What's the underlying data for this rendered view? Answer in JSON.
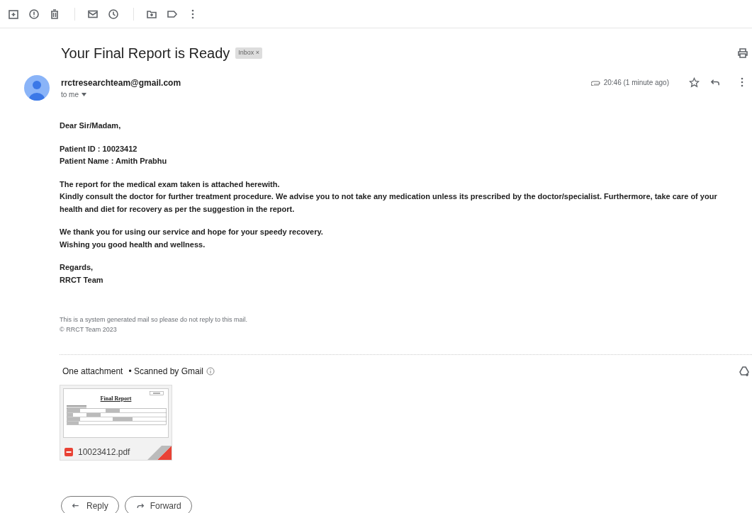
{
  "toolbar": {
    "buttons": [
      {
        "kind": "archive"
      },
      {
        "kind": "spam"
      },
      {
        "kind": "delete"
      },
      {
        "kind": "divider"
      },
      {
        "kind": "unread"
      },
      {
        "kind": "snooze"
      },
      {
        "kind": "divider"
      },
      {
        "kind": "move"
      },
      {
        "kind": "label"
      },
      {
        "kind": "more"
      }
    ]
  },
  "subject": "Your Final Report is Ready",
  "label_tag": {
    "text": "Inbox",
    "close": "×"
  },
  "sender": {
    "email": "rrctresearchteam@gmail.com",
    "to": "to me",
    "time": "20:46 (1 minute ago)",
    "has_attachment": true,
    "starred": false
  },
  "body": [
    {
      "lines": [
        "Dear Sir/Madam,"
      ]
    },
    {
      "lines": [
        "Patient ID : 10023412",
        "Patient Name : Amith Prabhu"
      ]
    },
    {
      "lines": [
        "The report for the medical exam taken is attached herewith.",
        "Kindly consult the doctor for further treatment procedure. We advise you to not take any medication unless its prescribed by the doctor/specialist. Furthermore, take care of your health and diet for recovery as per the suggestion in the report."
      ]
    },
    {
      "lines": [
        "We thank you for using our service and hope for your speedy recovery.",
        "Wishing you good health and wellness."
      ]
    },
    {
      "lines": [
        "Regards,",
        "RRCT Team"
      ]
    }
  ],
  "footer": [
    "This is a system generated mail so please do not reply to this mail.",
    "© RRCT Team 2023"
  ],
  "attachments": {
    "heading": "One attachment",
    "scan_note": "• Scanned by Gmail",
    "files": [
      {
        "name": "10023412.pdf",
        "preview_title": "Final Report"
      }
    ]
  },
  "actions": [
    {
      "kind": "reply",
      "label": "Reply"
    },
    {
      "kind": "forward",
      "label": "Forward"
    }
  ]
}
